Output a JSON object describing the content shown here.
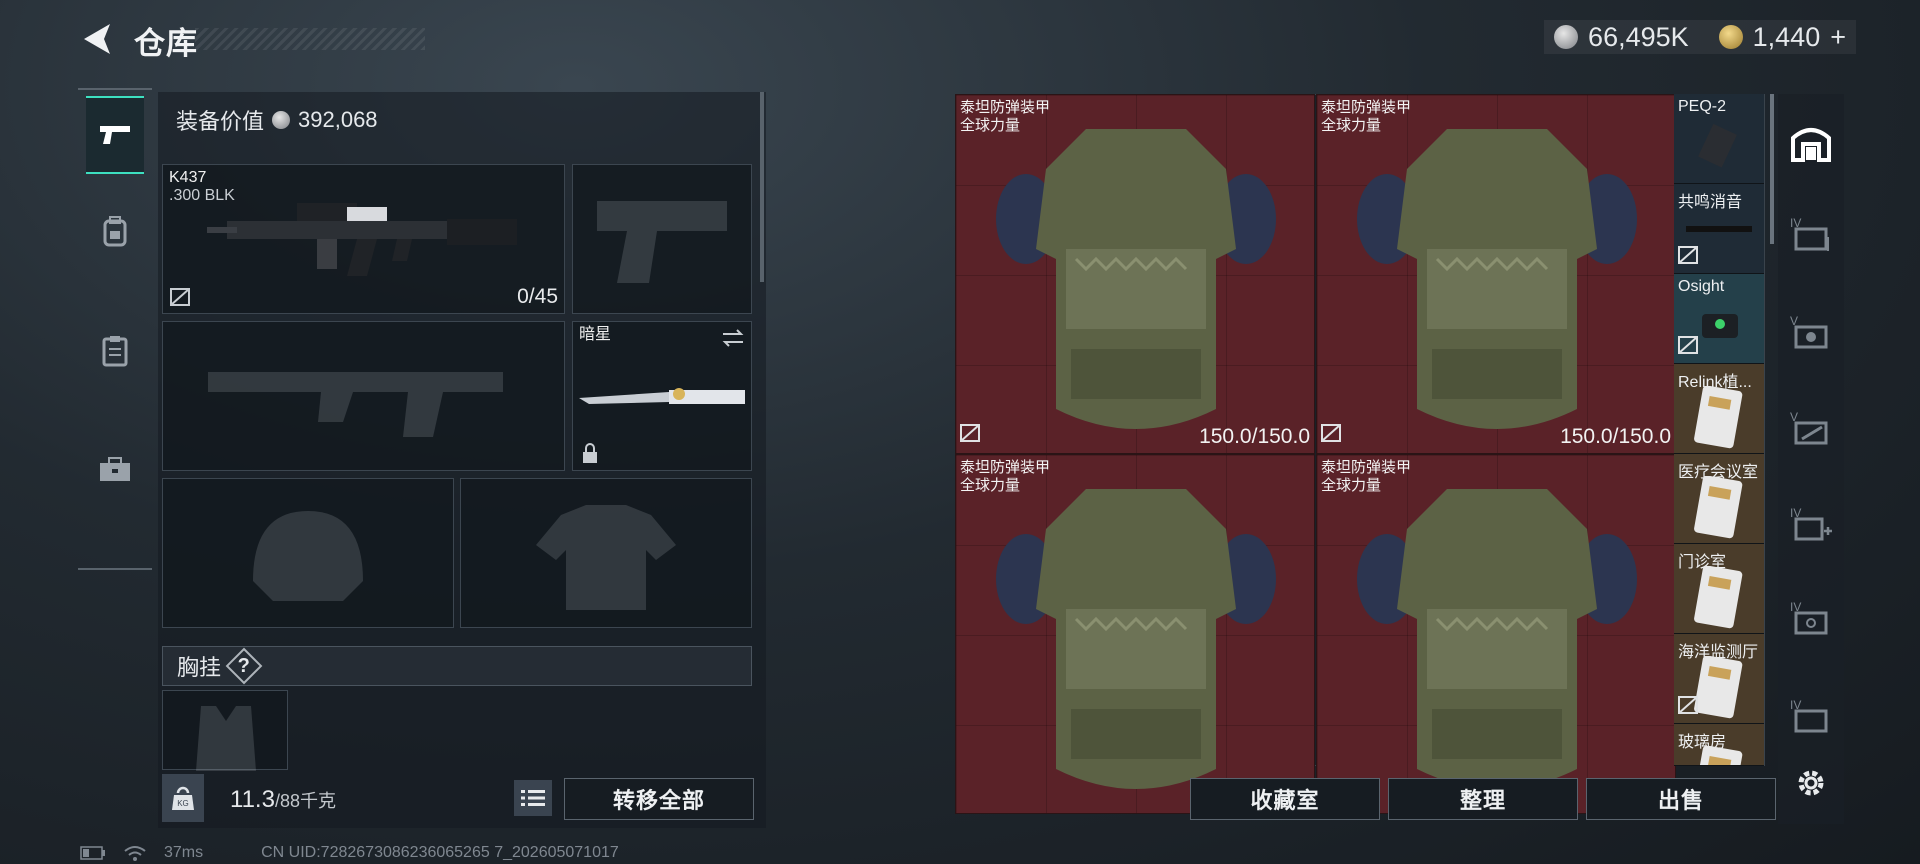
{
  "header": {
    "title": "仓库",
    "currency_silver": "66,495K",
    "currency_gold": "1,440",
    "add_label": "+"
  },
  "loadout": {
    "equipment_value_label": "装备价值",
    "equipment_value": "392,068",
    "primary_weapon": {
      "name": "K437",
      "caliber": ".300 BLK",
      "ammo": "0/45"
    },
    "melee": {
      "name": "暗星"
    },
    "vest_section": {
      "label": "胸挂",
      "help": "?"
    },
    "weight": "11.3",
    "weight_max": "/88千克",
    "transfer_all": "转移全部"
  },
  "stash": {
    "armors": [
      {
        "name": "泰坦防弹装甲",
        "sub": "全球力量",
        "durability": "150.0/150.0"
      },
      {
        "name": "泰坦防弹装甲",
        "sub": "全球力量",
        "durability": "150.0/150.0"
      },
      {
        "name": "泰坦防弹装甲",
        "sub": "全球力量",
        "durability": ""
      },
      {
        "name": "泰坦防弹装甲",
        "sub": "全球力量",
        "durability": ""
      }
    ],
    "side_items": [
      {
        "name": "PEQ-2"
      },
      {
        "name": "共鸣消音"
      },
      {
        "name": "Osight"
      },
      {
        "name": "Relink植..."
      },
      {
        "name": "医疗会议室"
      },
      {
        "name": "门诊室"
      },
      {
        "name": "海洋监测厅"
      },
      {
        "name": "玻璃房"
      }
    ]
  },
  "actions": {
    "collection": "收藏室",
    "organize": "整理",
    "sell": "出售"
  },
  "status": {
    "ping": "37ms",
    "uid": "CN UID:7282673086236065265 7_202605071017"
  },
  "colors": {
    "accent": "#3de0c0",
    "armor_bg": "#5a2228"
  }
}
